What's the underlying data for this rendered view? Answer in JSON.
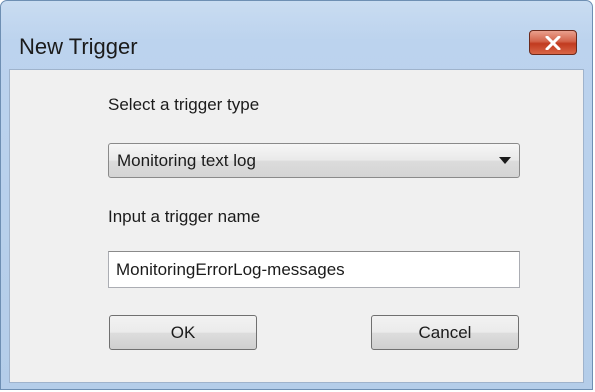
{
  "window": {
    "title": "New Trigger"
  },
  "form": {
    "type_label": "Select a trigger type",
    "type_selected": "Monitoring text log",
    "name_label": "Input a trigger name",
    "name_value": "MonitoringErrorLog-messages"
  },
  "buttons": {
    "ok_label": "OK",
    "cancel_label": "Cancel"
  },
  "icons": {
    "close": "close-icon",
    "dropdown": "chevron-down-icon"
  },
  "colors": {
    "close_button": "#c13a1f",
    "frame": "#bcd3ee",
    "client": "#f0f0f0"
  }
}
